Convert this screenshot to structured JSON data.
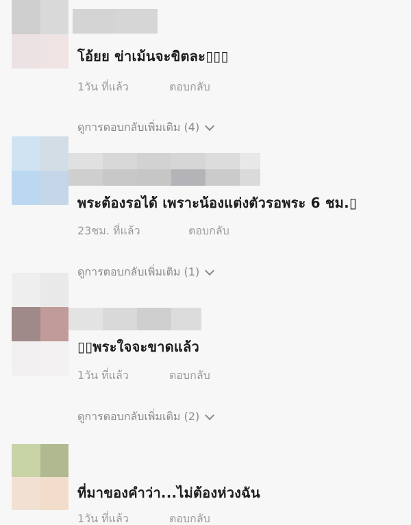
{
  "comments": [
    {
      "text": "โอ้ยย ข่าเม้นจะขิตละ▯▯▯",
      "time": "1วัน ที่แล้ว",
      "reply": "ตอบกลับ",
      "more_replies": "ดูการตอบกลับเพิ่มเติม (4)",
      "avatar_colors": [
        "#cfcfcf",
        "#d9d9d9",
        "#ece1e3",
        "#efe3e3"
      ],
      "name_colors": [
        "#d4d4d4",
        "#d4d4d4"
      ]
    },
    {
      "text": "พระต้องรอได้ เพราะน้องแต่งตัวรอพระ 6 ชม.▯",
      "time": "23ชม. ที่แล้ว",
      "reply": "ตอบกลับ",
      "more_replies": "ดูการตอบกลับเพิ่มเติม (1)",
      "avatar_colors": [
        "#cfe3f3",
        "#d3dde6",
        "#bcd8f1",
        "#c4d6e8"
      ],
      "name_colors": [
        "#dedede",
        "#d8d8d8",
        "#d0d0d0",
        "#bdbdbd",
        "#d3d3d3",
        "#dedede"
      ]
    },
    {
      "text": "▯▯พระใจจะขาดแล้ว",
      "time": "1วัน ที่แล้ว",
      "reply": "ตอบกลับ",
      "more_replies": "ดูการตอบกลับเพิ่มเติม (2)",
      "avatar_colors": [
        "#eeeeee",
        "#e9e9e9",
        "#a08a89",
        "#c19b99"
      ],
      "name_colors": [
        "#e3e3e3",
        "#dadada",
        "#cfcfcf",
        "#dcdcdc"
      ]
    },
    {
      "text": "ที่มาของคำว่า...ไม่ต้องห่วงฉัน",
      "time": "1วัน ที่แล้ว",
      "reply": "ตอบกลับ",
      "avatar_colors": [
        "#c8d4a6",
        "#b0b990",
        "#f2e1d2",
        "#f1ddc9"
      ]
    }
  ]
}
